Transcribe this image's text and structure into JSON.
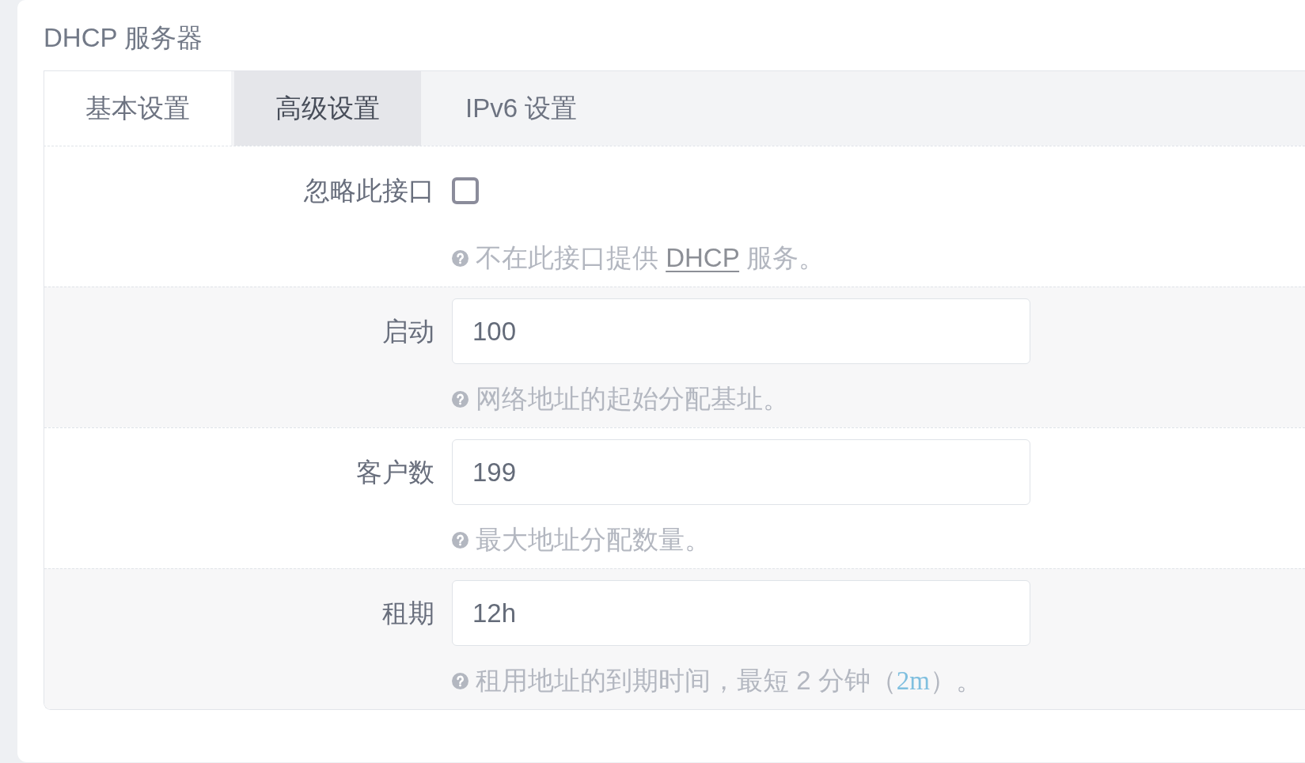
{
  "section_title": "DHCP 服务器",
  "tabs": [
    {
      "label": "基本设置",
      "selected": true,
      "hovered": false
    },
    {
      "label": "高级设置",
      "selected": false,
      "hovered": true
    },
    {
      "label": "IPv6 设置",
      "selected": false,
      "hovered": false
    }
  ],
  "fields": [
    {
      "label": "忽略此接口",
      "kind": "checkbox",
      "checked": false,
      "help": [
        {
          "kind": "text",
          "text": "不在此接口提供 "
        },
        {
          "kind": "abbr",
          "text": "DHCP"
        },
        {
          "kind": "text",
          "text": " 服务。"
        }
      ]
    },
    {
      "label": "启动",
      "kind": "text",
      "value": "100",
      "help": [
        {
          "kind": "text",
          "text": "网络地址的起始分配基址。"
        }
      ]
    },
    {
      "label": "客户数",
      "kind": "text",
      "value": "199",
      "help": [
        {
          "kind": "text",
          "text": "最大地址分配数量。"
        }
      ]
    },
    {
      "label": "租期",
      "kind": "text",
      "value": "12h",
      "help": [
        {
          "kind": "text",
          "text": "租用地址的到期时间，最短 2 分钟（"
        },
        {
          "kind": "code",
          "text": "2m"
        },
        {
          "kind": "text",
          "text": "）。"
        }
      ]
    }
  ]
}
